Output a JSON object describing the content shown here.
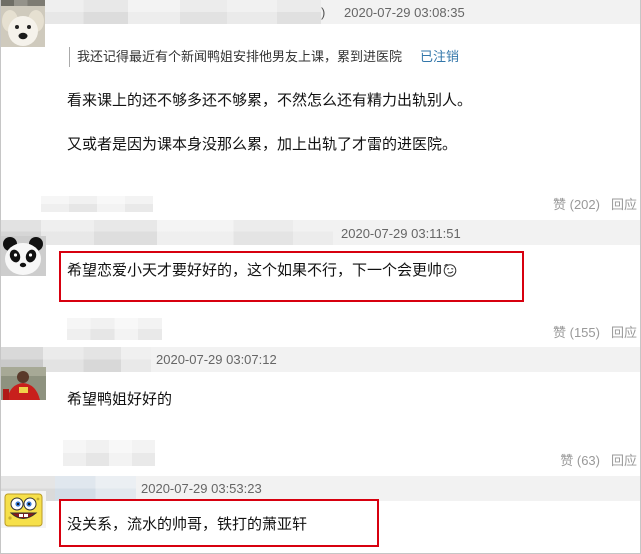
{
  "comments": [
    {
      "avatar_icon": "dog-avatar-icon",
      "name_fragment": ")",
      "timestamp": "2020-07-29 03:08:35",
      "quote": {
        "text": "我还记得最近有个新闻鸭姐安排他男友上课，累到进医院",
        "author": "已注销"
      },
      "paragraphs": [
        "看来课上的还不够多还不够累，不然怎么还有精力出轨别人。",
        "又或者是因为课本身没那么累，加上出轨了才雷的进医院。"
      ],
      "like": "赞 (202)",
      "reply": "回应",
      "highlighted": false
    },
    {
      "avatar_icon": "panda-avatar-icon",
      "timestamp": "2020-07-29 03:11:51",
      "paragraphs": [
        "希望恋爱小天才要好好的，这个如果不行，下一个会更帅"
      ],
      "emoji_icon": "smirk-emoji-icon",
      "like": "赞 (155)",
      "reply": "回应",
      "highlighted": true
    },
    {
      "avatar_icon": "red-jersey-photo-avatar",
      "timestamp": "2020-07-29 03:07:12",
      "paragraphs": [
        "希望鸭姐好好的"
      ],
      "like": "赞 (63)",
      "reply": "回应",
      "highlighted": false
    },
    {
      "avatar_icon": "spongebob-avatar-icon",
      "timestamp": "2020-07-29 03:53:23",
      "paragraphs": [
        "没关系，流水的帅哥，铁打的萧亚轩"
      ],
      "highlighted": true
    }
  ],
  "colors": {
    "highlight_box": "#d7000f",
    "link": "#3377aa",
    "meta_text": "#999999",
    "header_band": "#f2f2f2"
  }
}
